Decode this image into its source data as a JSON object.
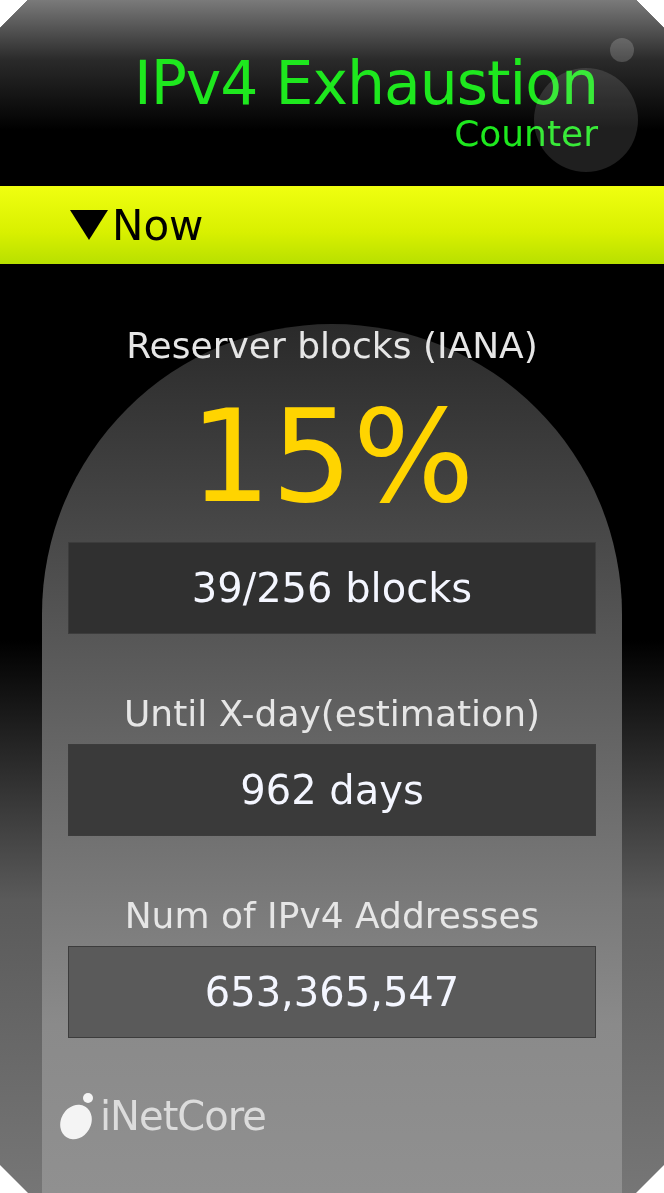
{
  "title": "IPv4 Exhaustion",
  "subtitle": "Counter",
  "section": {
    "label": "Now",
    "expanded": true
  },
  "stats": [
    {
      "kind": "percent",
      "label": "Reserver blocks (IANA)",
      "value": "15%",
      "detail": "39/256 blocks"
    },
    {
      "kind": "box",
      "label": "Until X-day(estimation)",
      "value": "962 days"
    },
    {
      "kind": "box",
      "label": "Num of IPv4 Addresses",
      "value": "653,365,547"
    }
  ],
  "footer": {
    "logo": "iNetCore"
  }
}
